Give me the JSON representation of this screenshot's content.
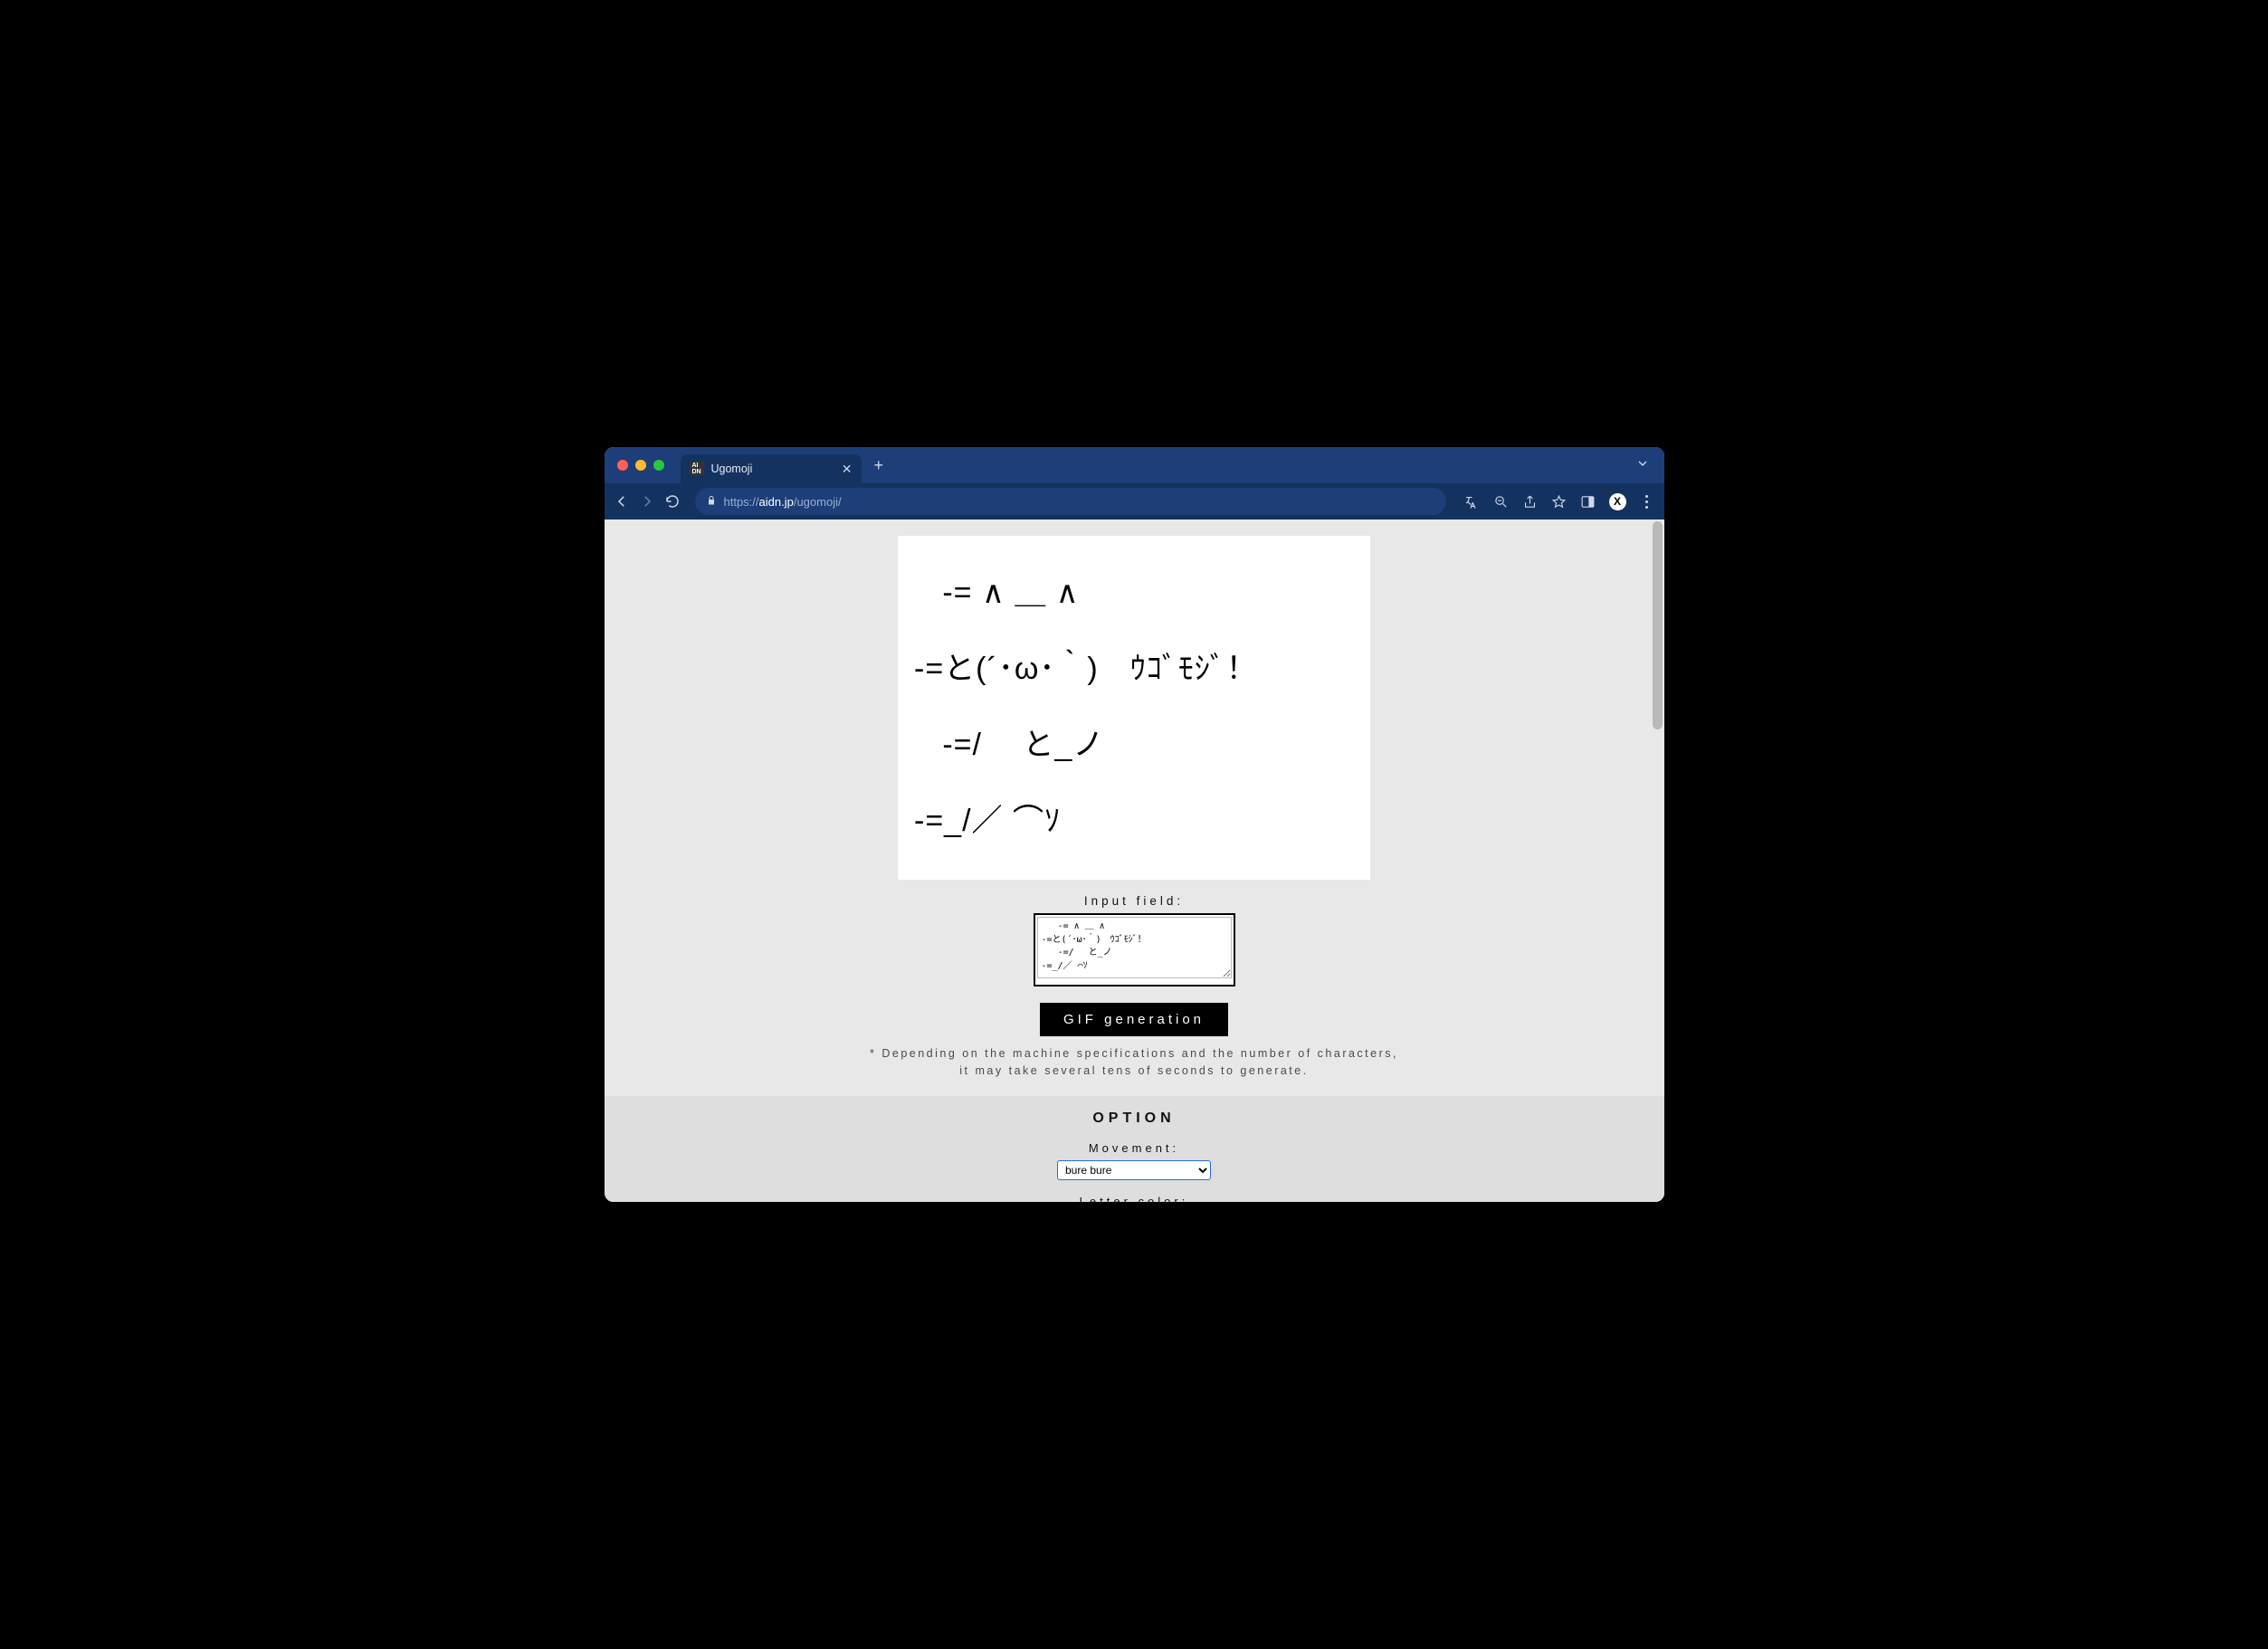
{
  "browser": {
    "tab_title": "Ugomoji",
    "url_prefix": "https://",
    "url_host": "aidn.jp",
    "url_path": "/ugomoji/",
    "avatar_letter": "X"
  },
  "main": {
    "canvas_lines": [
      "   -= ∧ ＿ ∧",
      "-=と(´･ω･｀)　ｳｺﾞﾓｼﾞ！",
      "   -=/　 と_ノ",
      "-=_/／ ⌒ｿ"
    ],
    "input_label": "Input field:",
    "input_value": "   -= ∧ ＿ ∧\n-=と(´･ω･｀)　ｳｺﾞﾓｼﾞ！\n   -=/　 と_ノ\n-=_/／ ⌒ｿ",
    "gen_button": "GIF generation",
    "note_line1": "* Depending on the machine specifications and the number of characters,",
    "note_line2": "it may take several tens of seconds to generate."
  },
  "option": {
    "heading": "OPTION",
    "movement_label": "Movement:",
    "movement_value": "bure bure",
    "letter_color_label": "Letter color:"
  }
}
